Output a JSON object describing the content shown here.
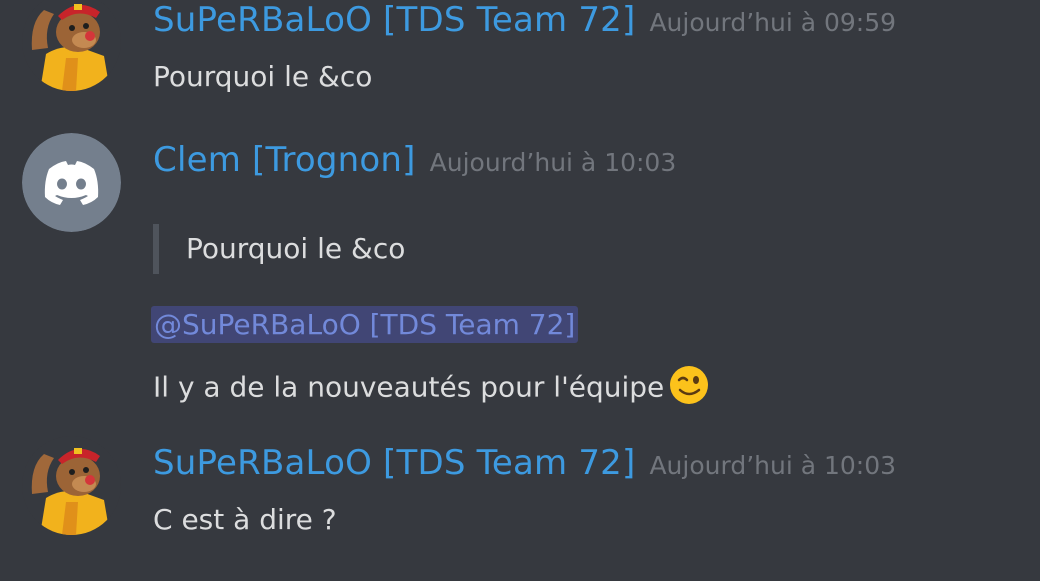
{
  "messages": [
    {
      "author": "SuPeRBaLoO [TDS Team 72]",
      "timestamp": "Aujourd’hui à 09:59",
      "avatar_icon": "bear-mascot-avatar-icon",
      "content": "Pourquoi le &co"
    },
    {
      "author": "Clem [Trognon]",
      "timestamp": "Aujourd’hui à 10:03",
      "avatar_icon": "discord-default-avatar-icon",
      "quote": "Pourquoi le &co",
      "mention": "@SuPeRBaLoO [TDS Team 72]",
      "content": "Il y a de la nouveautés pour l'équipe",
      "emoji": "winking-face-emoji"
    },
    {
      "author": "SuPeRBaLoO [TDS Team 72]",
      "timestamp": "Aujourd’hui à 10:03",
      "avatar_icon": "bear-mascot-avatar-icon",
      "content": "C est à dire ?"
    }
  ],
  "colors": {
    "background": "#36393f",
    "username": "#3d9ae0",
    "timestamp": "#72767d",
    "text": "#dcddde",
    "mention_bg": "#414675",
    "mention_text": "#7289da",
    "discord_avatar_bg": "#747f8d"
  }
}
